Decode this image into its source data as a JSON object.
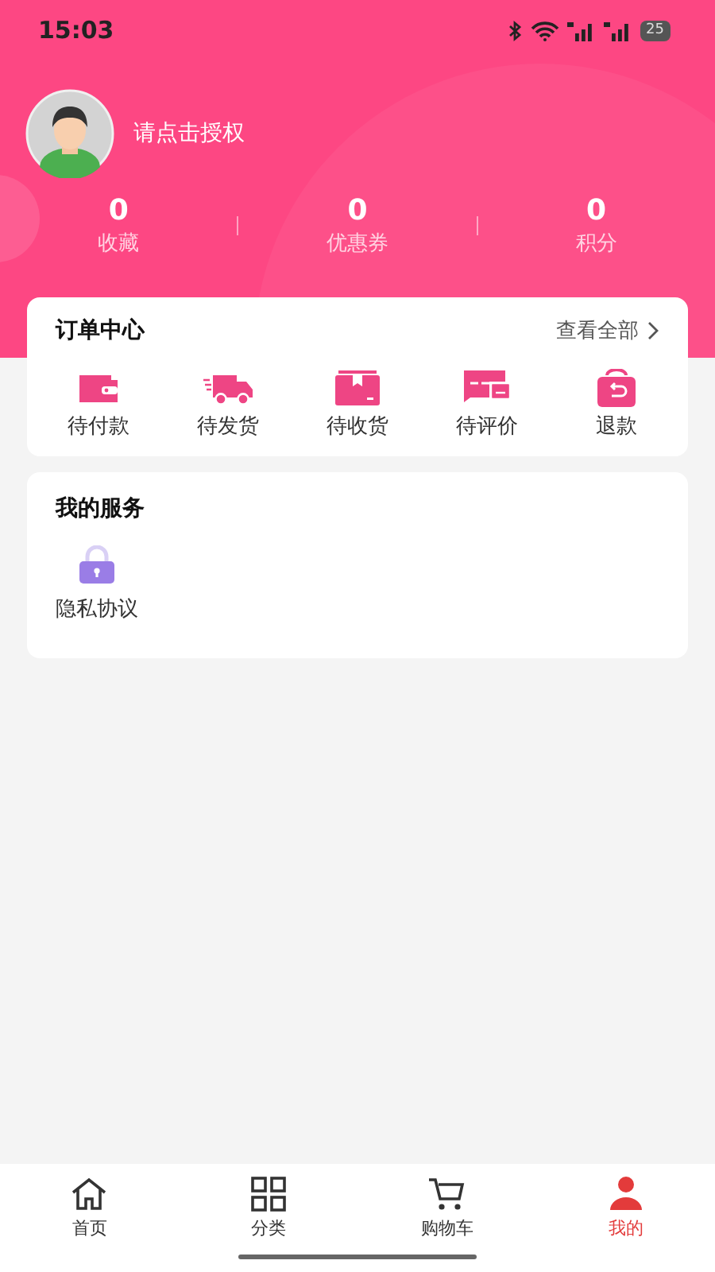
{
  "status_bar": {
    "time": "15:03",
    "battery": "25"
  },
  "profile": {
    "prompt": "请点击授权"
  },
  "stats": [
    {
      "value": "0",
      "label": "收藏"
    },
    {
      "value": "0",
      "label": "优惠券"
    },
    {
      "value": "0",
      "label": "积分"
    }
  ],
  "orders": {
    "title": "订单中心",
    "view_all": "查看全部",
    "items": [
      {
        "label": "待付款"
      },
      {
        "label": "待发货"
      },
      {
        "label": "待收货"
      },
      {
        "label": "待评价"
      },
      {
        "label": "退款"
      }
    ]
  },
  "services": {
    "title": "我的服务",
    "items": [
      {
        "label": "隐私协议"
      }
    ]
  },
  "tab_bar": [
    {
      "label": "首页",
      "selected": false
    },
    {
      "label": "分类",
      "selected": false
    },
    {
      "label": "购物车",
      "selected": false
    },
    {
      "label": "我的",
      "selected": true
    }
  ]
}
